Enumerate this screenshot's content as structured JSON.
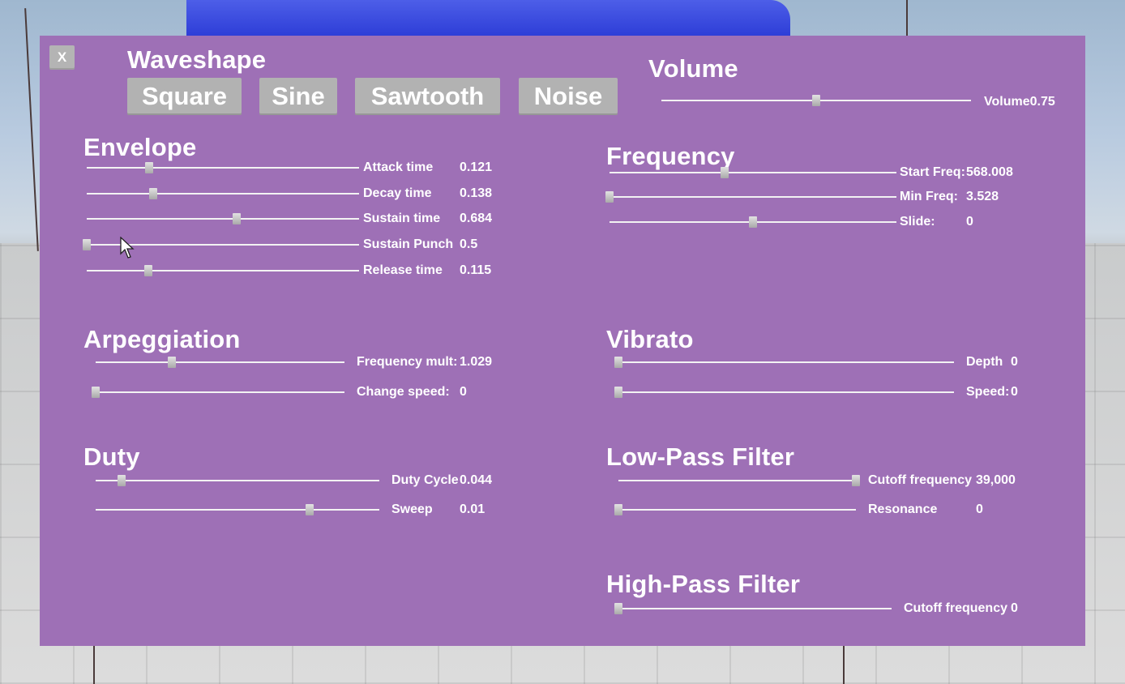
{
  "close_label": "X",
  "waveshape": {
    "title": "Waveshape",
    "buttons": [
      "Square",
      "Sine",
      "Sawtooth",
      "Noise"
    ]
  },
  "volume": {
    "title": "Volume",
    "label": "Volume",
    "value": "0.75",
    "level": 0.5
  },
  "envelope": {
    "title": "Envelope",
    "rows": [
      {
        "label": "Attack time",
        "value": "0.121",
        "level": 0.23
      },
      {
        "label": "Decay time",
        "value": "0.138",
        "level": 0.245
      },
      {
        "label": "Sustain time",
        "value": "0.684",
        "level": 0.55
      },
      {
        "label": "Sustain Punch",
        "value": "0.5",
        "level": 0.0
      },
      {
        "label": "Release time",
        "value": "0.115",
        "level": 0.225
      }
    ]
  },
  "frequency": {
    "title": "Frequency",
    "rows": [
      {
        "label": "Start Freq:",
        "value": "568.008",
        "level": 0.4
      },
      {
        "label": "Min Freq:",
        "value": "3.528",
        "level": 0.0
      },
      {
        "label": "Slide:",
        "value": "0",
        "level": 0.5
      }
    ]
  },
  "arpeggiation": {
    "title": "Arpeggiation",
    "rows": [
      {
        "label": "Frequency mult:",
        "value": "1.029",
        "level": 0.305
      },
      {
        "label": "Change speed:",
        "value": "0",
        "level": 0.0
      }
    ]
  },
  "vibrato": {
    "title": "Vibrato",
    "rows": [
      {
        "label": "Depth",
        "value": "0",
        "level": 0.0
      },
      {
        "label": "Speed:",
        "value": "0",
        "level": 0.0
      }
    ]
  },
  "duty": {
    "title": "Duty",
    "rows": [
      {
        "label": "Duty Cycle",
        "value": "0.044",
        "level": 0.09
      },
      {
        "label": "Sweep",
        "value": "0.01",
        "level": 0.755
      }
    ]
  },
  "lowpass": {
    "title": "Low-Pass Filter",
    "rows": [
      {
        "label": "Cutoff frequency",
        "value": "39,000",
        "level": 1.0
      },
      {
        "label": "Resonance",
        "value": "0",
        "level": 0.0
      }
    ]
  },
  "highpass": {
    "title": "High-Pass Filter",
    "rows": [
      {
        "label": "Cutoff frequency",
        "value": "0",
        "level": 0.0
      }
    ]
  }
}
